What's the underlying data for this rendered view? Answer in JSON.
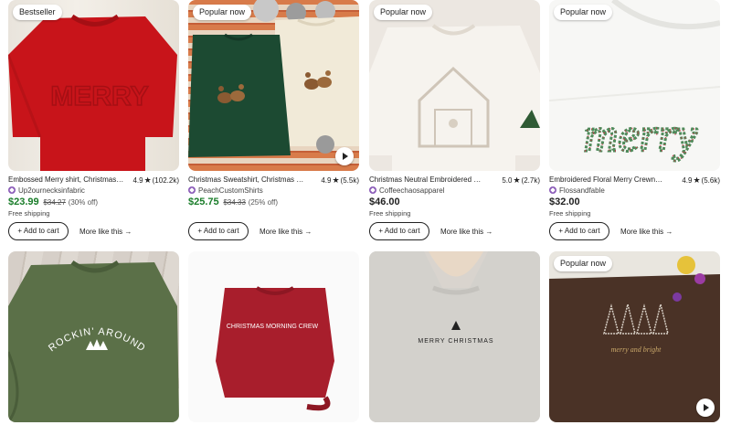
{
  "products": [
    {
      "badge": "Bestseller",
      "title": "Embossed Merry shirt, Christmas Sweatshirt, Merry Embossed",
      "rating": "4.9",
      "reviews": "(102.2k)",
      "shop": "Up2ournecksinfabric",
      "price": "$23.99",
      "original_price": "$34.27",
      "discount": "(30% off)",
      "shipping": "Free shipping",
      "video": false
    },
    {
      "badge": "Popular now",
      "title": "Christmas Sweatshirt, Christmas Reindeer Sweatshirt",
      "rating": "4.9",
      "reviews": "(5.5k)",
      "shop": "PeachCustomShirts",
      "price": "$25.75",
      "original_price": "$34.33",
      "discount": "(25% off)",
      "shipping": "",
      "video": true
    },
    {
      "badge": "Popular now",
      "title": "Christmas Neutral Embroidered Nativity Sweatshirt",
      "rating": "5.0",
      "reviews": "(2.7k)",
      "shop": "Coffeechaosapparel",
      "price": "$46.00",
      "original_price": "",
      "discount": "",
      "shipping": "Free shipping",
      "video": false
    },
    {
      "badge": "Popular now",
      "title": "Embroidered Floral Merry Crewneck Sweatshirt",
      "rating": "4.9",
      "reviews": "(5.6k)",
      "shop": "Flossandfable",
      "price": "$32.00",
      "original_price": "",
      "discount": "",
      "shipping": "Free shipping",
      "video": false
    },
    {
      "badge": "",
      "video": false
    },
    {
      "badge": "",
      "video": false
    },
    {
      "badge": "",
      "video": false
    },
    {
      "badge": "Popular now",
      "video": true
    }
  ],
  "labels": {
    "add_to_cart": "Add to cart",
    "more_like_this": "More like this",
    "star": "★",
    "plus": "+",
    "arrow": "→"
  },
  "image_text": {
    "merry_red": "MERRY",
    "christmas_morning_crew": "CHRISTMAS MORNING CREW",
    "rockin_around": "ROCKIN' AROUND",
    "merry_christmas": "MERRY CHRISTMAS",
    "merry_floral": "merry",
    "merry_and_bright": "merry and bright"
  },
  "colors": {
    "sale": "#1a7d2a",
    "shop_icon": "#8b5cb8"
  }
}
